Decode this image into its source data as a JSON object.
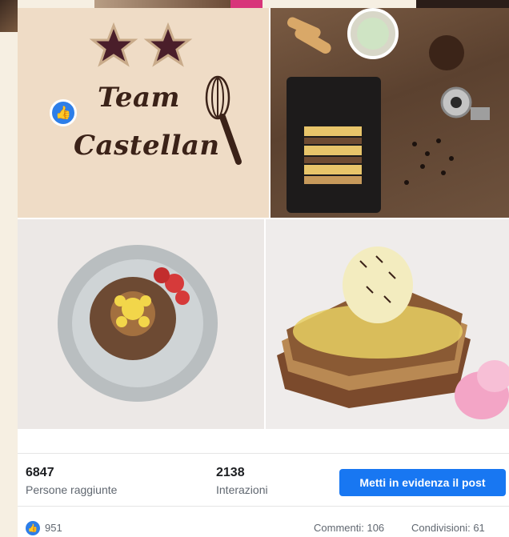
{
  "post": {
    "logo": {
      "line1": "Team",
      "line2": "Castellan"
    },
    "stats": {
      "reach_value": "6847",
      "reach_label": "Persone raggiunte",
      "interactions_value": "2138",
      "interactions_label": "Interazioni"
    },
    "boost_button": "Metti in evidenza il post",
    "reactions_count": "951",
    "comments": "Commenti: 106",
    "shares": "Condivisioni: 61"
  },
  "colors": {
    "brand_blue": "#1877f2",
    "logo_brown": "#3b2218",
    "logo_bg": "#efdcc6"
  },
  "icons": [
    "like-icon",
    "star-icon",
    "whisk-icon"
  ]
}
